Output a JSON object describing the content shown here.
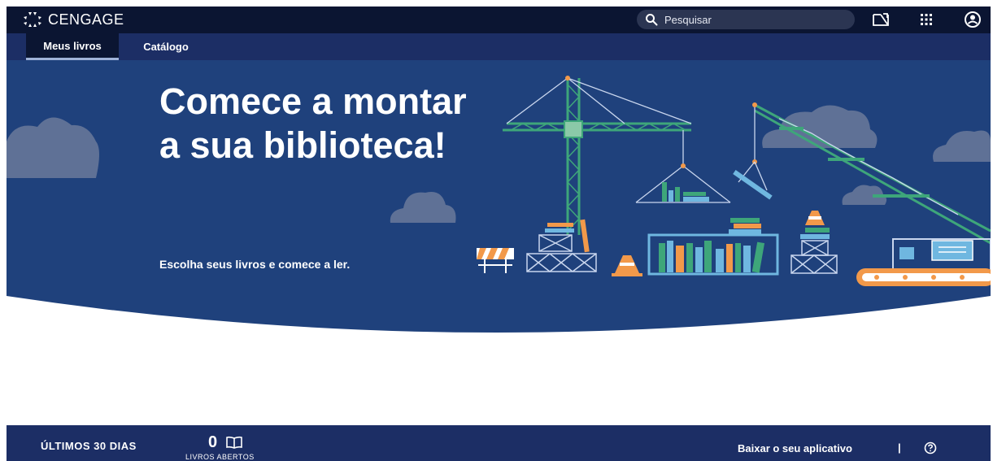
{
  "header": {
    "logo_text": "CENGAGE",
    "search_placeholder": "Pesquisar",
    "icons": [
      "notes-icon",
      "apps-grid-icon",
      "account-icon"
    ]
  },
  "nav": {
    "tabs": [
      {
        "label": "Meus livros",
        "active": true
      },
      {
        "label": "Catálogo",
        "active": false
      }
    ]
  },
  "hero": {
    "title": "Comece a montar a sua biblioteca!",
    "subtitle": "Escolha seus livros e comece a ler."
  },
  "footer": {
    "period_label": "ÚLTIMOS 30 DIAS",
    "books_opened_count": "0",
    "books_opened_label": "LIVROS ABERTOS",
    "app_link": "Baixar o seu aplicativo",
    "divider": "|"
  },
  "colors": {
    "topbar": "#0b1532",
    "navbar": "#1c2e65",
    "hero_bg": "#1f417c",
    "cloud": "#5f7196",
    "crane_green": "#3ea67a",
    "accent_orange": "#f2994a"
  }
}
